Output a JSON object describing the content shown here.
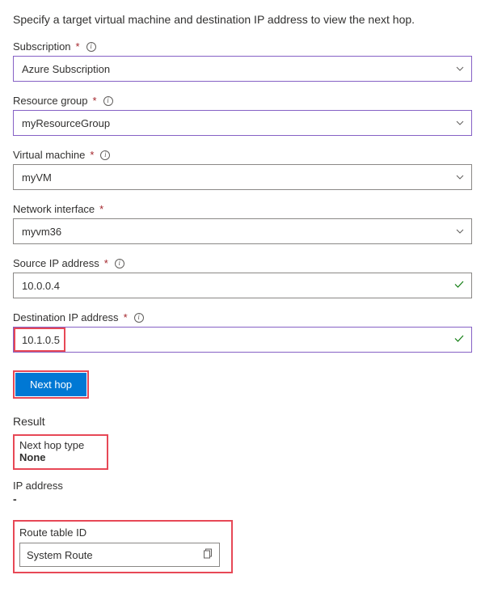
{
  "description": "Specify a target virtual machine and destination IP address to view the next hop.",
  "fields": {
    "subscription": {
      "label": "Subscription",
      "value": "Azure Subscription"
    },
    "resource_group": {
      "label": "Resource group",
      "value": "myResourceGroup"
    },
    "virtual_machine": {
      "label": "Virtual machine",
      "value": "myVM"
    },
    "network_interface": {
      "label": "Network interface",
      "value": "myvm36"
    },
    "source_ip": {
      "label": "Source IP address",
      "value": "10.0.0.4"
    },
    "destination_ip": {
      "label": "Destination IP address",
      "value": "10.1.0.5"
    }
  },
  "button": {
    "next_hop": "Next hop"
  },
  "result": {
    "heading": "Result",
    "next_hop_type_label": "Next hop type",
    "next_hop_type_value": "None",
    "ip_address_label": "IP address",
    "ip_address_value": "-",
    "route_table_label": "Route table ID",
    "route_table_value": "System Route"
  }
}
